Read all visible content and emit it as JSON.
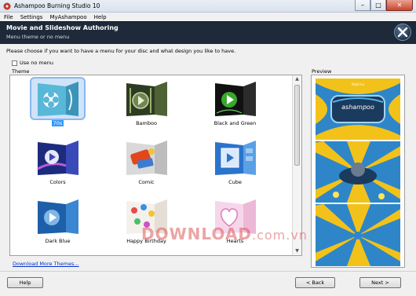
{
  "window": {
    "title": "Ashampoo Burning Studio 10",
    "controls": {
      "minimize": "–",
      "maximize": "□",
      "close": "✕"
    }
  },
  "menu": [
    "File",
    "Settings",
    "MyAshampoo",
    "Help"
  ],
  "header": {
    "title": "Movie and Slideshow Authoring",
    "subtitle": "Menu theme or no menu"
  },
  "instruction": "Please choose if you want to have a menu for your disc and what design you like to have.",
  "use_no_menu": {
    "label": "Use no menu",
    "checked": false
  },
  "theme_group_label": "Theme",
  "preview_group_label": "Preview",
  "themes": [
    {
      "label": "70s",
      "selected": true
    },
    {
      "label": "Bamboo",
      "selected": false
    },
    {
      "label": "Black and Green",
      "selected": false
    },
    {
      "label": "Colors",
      "selected": false
    },
    {
      "label": "Comic",
      "selected": false
    },
    {
      "label": "Cube",
      "selected": false
    },
    {
      "label": "Dark Blue",
      "selected": false
    },
    {
      "label": "Happy Birthday",
      "selected": false
    },
    {
      "label": "Hearts",
      "selected": false
    }
  ],
  "download_link": "Download More Themes...",
  "preview_logo": "ashampoo",
  "buttons": {
    "help": "Help",
    "back": "< Back",
    "next": "Next >"
  },
  "watermark": {
    "brand": "DOWNLOAD",
    "suffix": ".com.vn"
  },
  "colors": {
    "header_bg": "#1e2a3a",
    "selection": "#3399ff",
    "link": "#0033cc",
    "preview_blue": "#2e86c8",
    "preview_yellow": "#f2c21b"
  }
}
